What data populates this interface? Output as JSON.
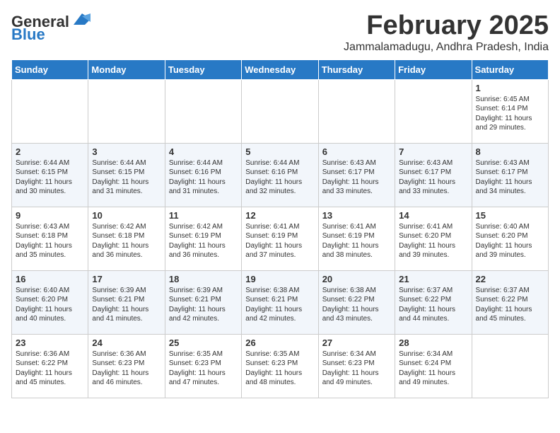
{
  "logo": {
    "general": "General",
    "blue": "Blue"
  },
  "title": "February 2025",
  "subtitle": "Jammalamadugu, Andhra Pradesh, India",
  "days_of_week": [
    "Sunday",
    "Monday",
    "Tuesday",
    "Wednesday",
    "Thursday",
    "Friday",
    "Saturday"
  ],
  "weeks": [
    [
      {
        "day": "",
        "text": ""
      },
      {
        "day": "",
        "text": ""
      },
      {
        "day": "",
        "text": ""
      },
      {
        "day": "",
        "text": ""
      },
      {
        "day": "",
        "text": ""
      },
      {
        "day": "",
        "text": ""
      },
      {
        "day": "1",
        "text": "Sunrise: 6:45 AM\nSunset: 6:14 PM\nDaylight: 11 hours and 29 minutes."
      }
    ],
    [
      {
        "day": "2",
        "text": "Sunrise: 6:44 AM\nSunset: 6:15 PM\nDaylight: 11 hours and 30 minutes."
      },
      {
        "day": "3",
        "text": "Sunrise: 6:44 AM\nSunset: 6:15 PM\nDaylight: 11 hours and 31 minutes."
      },
      {
        "day": "4",
        "text": "Sunrise: 6:44 AM\nSunset: 6:16 PM\nDaylight: 11 hours and 31 minutes."
      },
      {
        "day": "5",
        "text": "Sunrise: 6:44 AM\nSunset: 6:16 PM\nDaylight: 11 hours and 32 minutes."
      },
      {
        "day": "6",
        "text": "Sunrise: 6:43 AM\nSunset: 6:17 PM\nDaylight: 11 hours and 33 minutes."
      },
      {
        "day": "7",
        "text": "Sunrise: 6:43 AM\nSunset: 6:17 PM\nDaylight: 11 hours and 33 minutes."
      },
      {
        "day": "8",
        "text": "Sunrise: 6:43 AM\nSunset: 6:17 PM\nDaylight: 11 hours and 34 minutes."
      }
    ],
    [
      {
        "day": "9",
        "text": "Sunrise: 6:43 AM\nSunset: 6:18 PM\nDaylight: 11 hours and 35 minutes."
      },
      {
        "day": "10",
        "text": "Sunrise: 6:42 AM\nSunset: 6:18 PM\nDaylight: 11 hours and 36 minutes."
      },
      {
        "day": "11",
        "text": "Sunrise: 6:42 AM\nSunset: 6:19 PM\nDaylight: 11 hours and 36 minutes."
      },
      {
        "day": "12",
        "text": "Sunrise: 6:41 AM\nSunset: 6:19 PM\nDaylight: 11 hours and 37 minutes."
      },
      {
        "day": "13",
        "text": "Sunrise: 6:41 AM\nSunset: 6:19 PM\nDaylight: 11 hours and 38 minutes."
      },
      {
        "day": "14",
        "text": "Sunrise: 6:41 AM\nSunset: 6:20 PM\nDaylight: 11 hours and 39 minutes."
      },
      {
        "day": "15",
        "text": "Sunrise: 6:40 AM\nSunset: 6:20 PM\nDaylight: 11 hours and 39 minutes."
      }
    ],
    [
      {
        "day": "16",
        "text": "Sunrise: 6:40 AM\nSunset: 6:20 PM\nDaylight: 11 hours and 40 minutes."
      },
      {
        "day": "17",
        "text": "Sunrise: 6:39 AM\nSunset: 6:21 PM\nDaylight: 11 hours and 41 minutes."
      },
      {
        "day": "18",
        "text": "Sunrise: 6:39 AM\nSunset: 6:21 PM\nDaylight: 11 hours and 42 minutes."
      },
      {
        "day": "19",
        "text": "Sunrise: 6:38 AM\nSunset: 6:21 PM\nDaylight: 11 hours and 42 minutes."
      },
      {
        "day": "20",
        "text": "Sunrise: 6:38 AM\nSunset: 6:22 PM\nDaylight: 11 hours and 43 minutes."
      },
      {
        "day": "21",
        "text": "Sunrise: 6:37 AM\nSunset: 6:22 PM\nDaylight: 11 hours and 44 minutes."
      },
      {
        "day": "22",
        "text": "Sunrise: 6:37 AM\nSunset: 6:22 PM\nDaylight: 11 hours and 45 minutes."
      }
    ],
    [
      {
        "day": "23",
        "text": "Sunrise: 6:36 AM\nSunset: 6:22 PM\nDaylight: 11 hours and 45 minutes."
      },
      {
        "day": "24",
        "text": "Sunrise: 6:36 AM\nSunset: 6:23 PM\nDaylight: 11 hours and 46 minutes."
      },
      {
        "day": "25",
        "text": "Sunrise: 6:35 AM\nSunset: 6:23 PM\nDaylight: 11 hours and 47 minutes."
      },
      {
        "day": "26",
        "text": "Sunrise: 6:35 AM\nSunset: 6:23 PM\nDaylight: 11 hours and 48 minutes."
      },
      {
        "day": "27",
        "text": "Sunrise: 6:34 AM\nSunset: 6:23 PM\nDaylight: 11 hours and 49 minutes."
      },
      {
        "day": "28",
        "text": "Sunrise: 6:34 AM\nSunset: 6:24 PM\nDaylight: 11 hours and 49 minutes."
      },
      {
        "day": "",
        "text": ""
      }
    ]
  ]
}
